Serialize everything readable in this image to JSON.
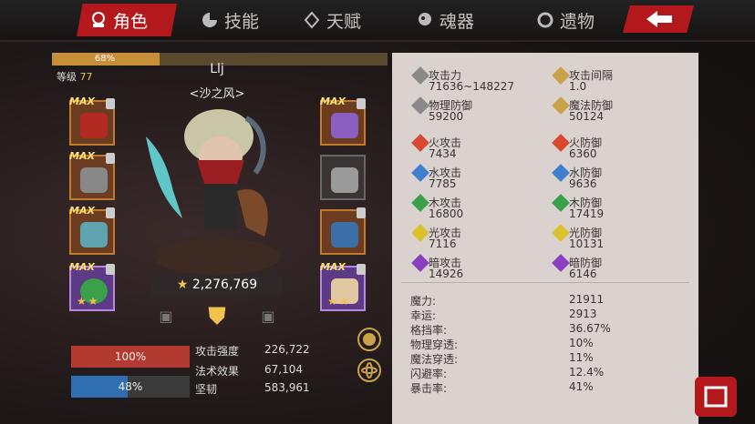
{
  "nav": {
    "tabs": [
      {
        "label": "角色",
        "icon": "character-icon"
      },
      {
        "label": "技能",
        "icon": "skill-icon"
      },
      {
        "label": "天赋",
        "icon": "talent-icon"
      },
      {
        "label": "魂器",
        "icon": "soul-icon"
      },
      {
        "label": "遗物",
        "icon": "relic-icon"
      }
    ],
    "accent": "#b3191c"
  },
  "player": {
    "xp_percent_label": "68%",
    "xp_fraction": 0.32,
    "level_label": "等级",
    "level": "77",
    "name": "Llj",
    "guild": "<沙之风>",
    "power": "2,276,769"
  },
  "equipment": {
    "left": [
      {
        "badge": "MAX",
        "stars": ""
      },
      {
        "badge": "MAX",
        "stars": ""
      },
      {
        "badge": "MAX",
        "stars": ""
      },
      {
        "badge": "MAX",
        "stars": "★★"
      }
    ],
    "right": [
      {
        "badge": "MAX",
        "stars": ""
      },
      {
        "badge": "",
        "stars": ""
      },
      {
        "badge": "",
        "stars": ""
      },
      {
        "badge": "MAX",
        "stars": "★★"
      }
    ]
  },
  "bars": {
    "hp_label": "100%",
    "hp_fraction": 1.0,
    "mp_label": "48%",
    "mp_fraction": 0.48
  },
  "stats_left": [
    {
      "label": "攻击强度",
      "value": "226,722"
    },
    {
      "label": "法术效果",
      "value": "67,104"
    },
    {
      "label": "坚韧",
      "value": "583,961"
    }
  ],
  "attributes": [
    {
      "label": "攻击力",
      "value": "71636~148227",
      "icon": "sword-icon",
      "color": "#8a8a8a"
    },
    {
      "label": "攻击间隔",
      "value": "1.0",
      "icon": "speed-icon",
      "color": "#c9a24a"
    },
    {
      "label": "物理防御",
      "value": "59200",
      "icon": "shield-icon",
      "color": "#8a8a8a"
    },
    {
      "label": "魔法防御",
      "value": "50124",
      "icon": "magic-shield-icon",
      "color": "#c9a24a"
    },
    {
      "label": "火攻击",
      "value": "7434",
      "icon": "fire-attack-icon",
      "color": "#d9482f"
    },
    {
      "label": "火防御",
      "value": "6360",
      "icon": "fire-defense-icon",
      "color": "#d9482f"
    },
    {
      "label": "水攻击",
      "value": "7785",
      "icon": "water-attack-icon",
      "color": "#3f7fd0"
    },
    {
      "label": "水防御",
      "value": "9636",
      "icon": "water-defense-icon",
      "color": "#3f7fd0"
    },
    {
      "label": "木攻击",
      "value": "16800",
      "icon": "wood-attack-icon",
      "color": "#3aa04a"
    },
    {
      "label": "木防御",
      "value": "17419",
      "icon": "wood-defense-icon",
      "color": "#3aa04a"
    },
    {
      "label": "光攻击",
      "value": "7116",
      "icon": "light-attack-icon",
      "color": "#d9c12f"
    },
    {
      "label": "光防御",
      "value": "10131",
      "icon": "light-defense-icon",
      "color": "#d9c12f"
    },
    {
      "label": "暗攻击",
      "value": "14926",
      "icon": "dark-attack-icon",
      "color": "#8a3fc0"
    },
    {
      "label": "暗防御",
      "value": "6146",
      "icon": "dark-defense-icon",
      "color": "#8a3fc0"
    }
  ],
  "misc_stats": [
    {
      "label": "魔力:",
      "value": "21911"
    },
    {
      "label": "幸运:",
      "value": "2913"
    },
    {
      "label": "格挡率:",
      "value": "36.67%"
    },
    {
      "label": "物理穿透:",
      "value": "10%"
    },
    {
      "label": "魔法穿透:",
      "value": "11%"
    },
    {
      "label": "闪避率:",
      "value": "12.4%"
    },
    {
      "label": "暴击率:",
      "value": "41%"
    }
  ]
}
